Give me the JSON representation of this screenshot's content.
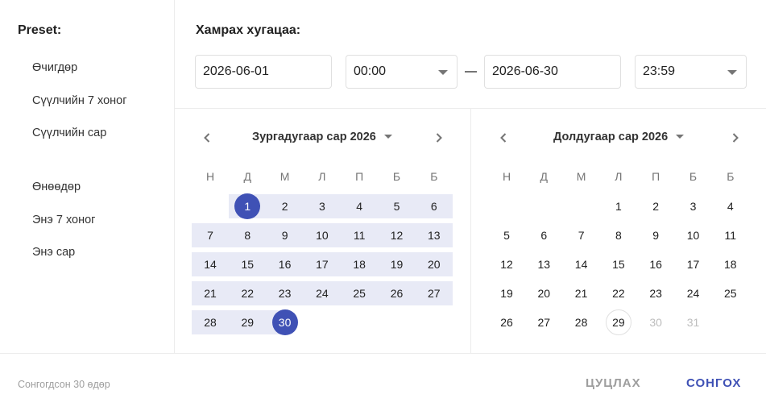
{
  "sidebar": {
    "title": "Preset:",
    "items": [
      {
        "label": "Өчигдөр"
      },
      {
        "label": "Сүүлчийн 7 хоног"
      },
      {
        "label": "Сүүлчийн сар"
      },
      {
        "label": "Өнөөдөр"
      },
      {
        "label": "Энэ 7 хоног"
      },
      {
        "label": "Энэ сар"
      }
    ]
  },
  "range": {
    "title": "Хамрах хугацаа:",
    "start_date": "2026-06-01",
    "start_time": "00:00",
    "end_date": "2026-06-30",
    "end_time": "23:59"
  },
  "calendars": {
    "weekdays": [
      "Н",
      "Д",
      "М",
      "Л",
      "П",
      "Б",
      "Б"
    ],
    "left": {
      "label": "Зургадугаар сар 2026",
      "days": [
        "1",
        "2",
        "3",
        "4",
        "5",
        "6",
        "7",
        "8",
        "9",
        "10",
        "11",
        "12",
        "13",
        "14",
        "15",
        "16",
        "17",
        "18",
        "19",
        "20",
        "21",
        "22",
        "23",
        "24",
        "25",
        "26",
        "27",
        "28",
        "29",
        "30"
      ],
      "selected_start": "1",
      "selected_end": "30"
    },
    "right": {
      "label": "Долдугаар сар 2026",
      "days": [
        "1",
        "2",
        "3",
        "4",
        "5",
        "6",
        "7",
        "8",
        "9",
        "10",
        "11",
        "12",
        "13",
        "14",
        "15",
        "16",
        "17",
        "18",
        "19",
        "20",
        "21",
        "22",
        "23",
        "24",
        "25",
        "26",
        "27",
        "28",
        "29",
        "30",
        "31"
      ],
      "today": "29",
      "disabled": [
        "30",
        "31"
      ]
    }
  },
  "footer": {
    "selected_text": "Сонгогдсон 30  өдөр",
    "cancel_label": "ЦУЦЛАХ",
    "select_label": "СОНГОХ"
  },
  "colors": {
    "accent": "#3f51b5",
    "range_background": "#e8eaf6",
    "muted_text": "#9e9e9e"
  },
  "icons": {
    "prev": "chevron-left-icon",
    "next": "chevron-right-icon",
    "dropdown": "caret-down-icon"
  }
}
